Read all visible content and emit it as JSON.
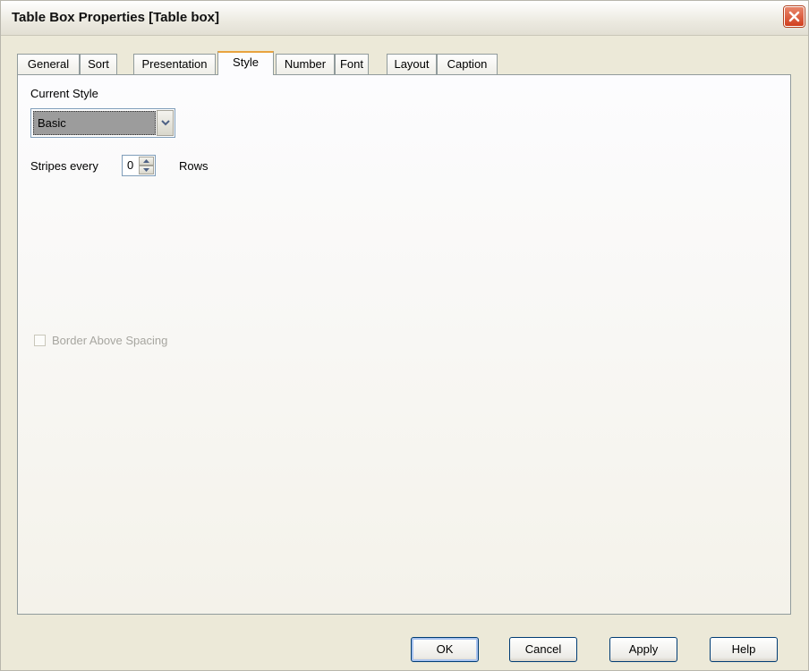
{
  "window": {
    "title": "Table Box Properties [Table box]"
  },
  "tabs": [
    {
      "label": "General"
    },
    {
      "label": "Sort"
    },
    {
      "label": "Presentation"
    },
    {
      "label": "Style",
      "active": true
    },
    {
      "label": "Number"
    },
    {
      "label": "Font"
    },
    {
      "label": "Layout"
    },
    {
      "label": "Caption"
    }
  ],
  "style_tab": {
    "current_style_label": "Current Style",
    "current_style_value": "Basic",
    "stripes_label": "Stripes every",
    "stripes_value": "0",
    "rows_label": "Rows",
    "border_above_spacing_label": "Border Above Spacing",
    "border_above_spacing_checked": false,
    "border_above_spacing_enabled": false
  },
  "buttons": {
    "ok": "OK",
    "cancel": "Cancel",
    "apply": "Apply",
    "help": "Help"
  },
  "icons": {
    "close": "close-icon",
    "dropdown": "chevron-down-icon",
    "spin_up": "triangle-up-icon",
    "spin_down": "triangle-down-icon"
  }
}
